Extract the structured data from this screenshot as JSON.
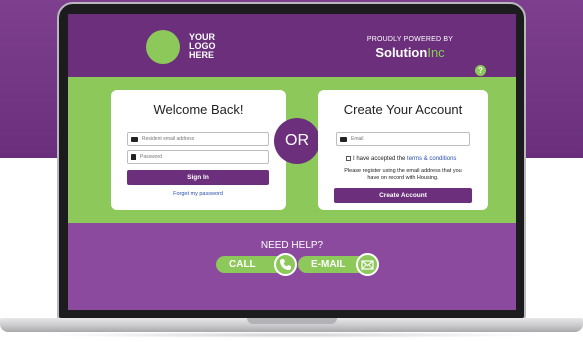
{
  "logo": {
    "lines": [
      "YOUR",
      "LOGO",
      "HERE"
    ]
  },
  "powered_by": {
    "label": "PROUDLY POWERED BY",
    "brand_bold": "Solution",
    "brand_light": "Inc"
  },
  "help_icon": "?",
  "login": {
    "title": "Welcome Back!",
    "email_placeholder": "Resident email address",
    "password_placeholder": "Password",
    "sign_in": "Sign In",
    "forgot": "Forget my password"
  },
  "divider": "OR",
  "signup": {
    "title": "Create Your Account",
    "email_placeholder": "Email",
    "terms_prefix": "I have accepted the ",
    "terms_link": "terms & conditions",
    "note": "Please register using the email address that you have on record with Housing.",
    "create": "Create Account"
  },
  "help": {
    "title": "NEED HELP?",
    "call": "CALL",
    "email": "E-MAIL"
  },
  "colors": {
    "purple": "#6b2f7b",
    "green": "#8cc85a",
    "link": "#2a4fb0"
  }
}
